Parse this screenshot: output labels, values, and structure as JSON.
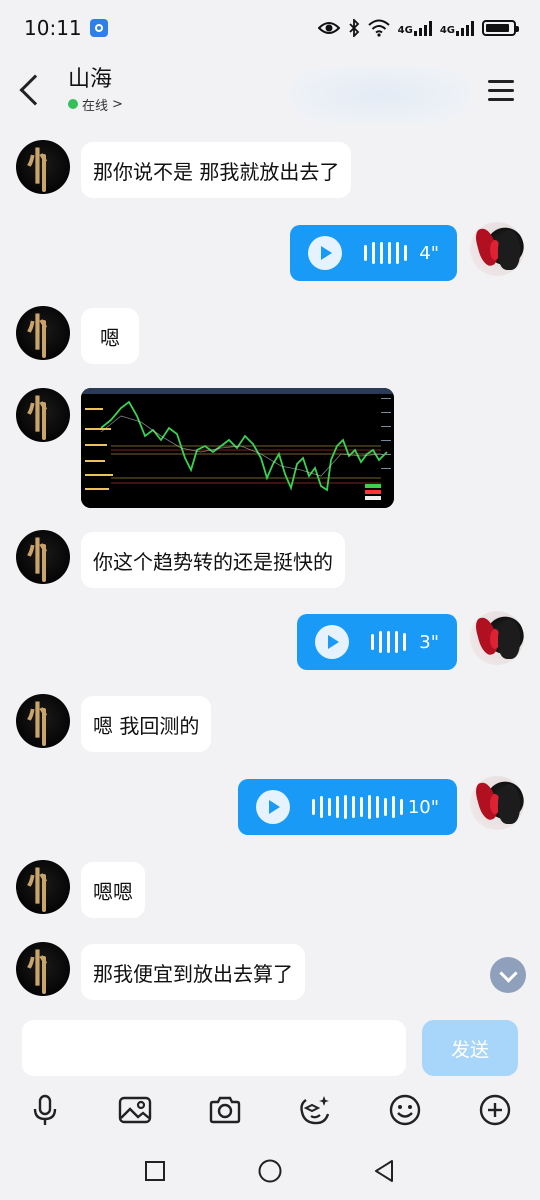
{
  "status_bar": {
    "time": "10:11",
    "network1": "4G",
    "network2": "4G",
    "battery_level": 0.9
  },
  "header": {
    "contact_name": "山海",
    "presence": "在线",
    "presence_chevron": ">",
    "back_icon": "back-chevron-icon",
    "menu_icon": "hamburger-menu-icon"
  },
  "messages": [
    {
      "type": "text",
      "side": "left",
      "text": "那你说不是 那我就放出去了"
    },
    {
      "type": "voice",
      "side": "right",
      "duration": "4\""
    },
    {
      "type": "text",
      "side": "left",
      "text": "嗯"
    },
    {
      "type": "image",
      "side": "left",
      "description": "stock-chart-image"
    },
    {
      "type": "text",
      "side": "left",
      "text": "你这个趋势转的还是挺快的"
    },
    {
      "type": "voice",
      "side": "right",
      "duration": "3\""
    },
    {
      "type": "text",
      "side": "left",
      "text": "嗯 我回测的"
    },
    {
      "type": "voice",
      "side": "right",
      "duration": "10\""
    },
    {
      "type": "text",
      "side": "left",
      "text": "嗯嗯"
    },
    {
      "type": "text",
      "side": "left",
      "text": "那我便宜到放出去算了"
    }
  ],
  "input": {
    "value": "",
    "placeholder": "",
    "send_label": "发送"
  },
  "toolbar": {
    "items": [
      "microphone-icon",
      "image-icon",
      "camera-icon",
      "sticker-icon",
      "emoji-icon",
      "plus-icon"
    ]
  },
  "colors": {
    "accent": "#1a9af7",
    "send_disabled": "#a8d6fb",
    "background": "#f2f2f5",
    "online": "#35c15a"
  }
}
